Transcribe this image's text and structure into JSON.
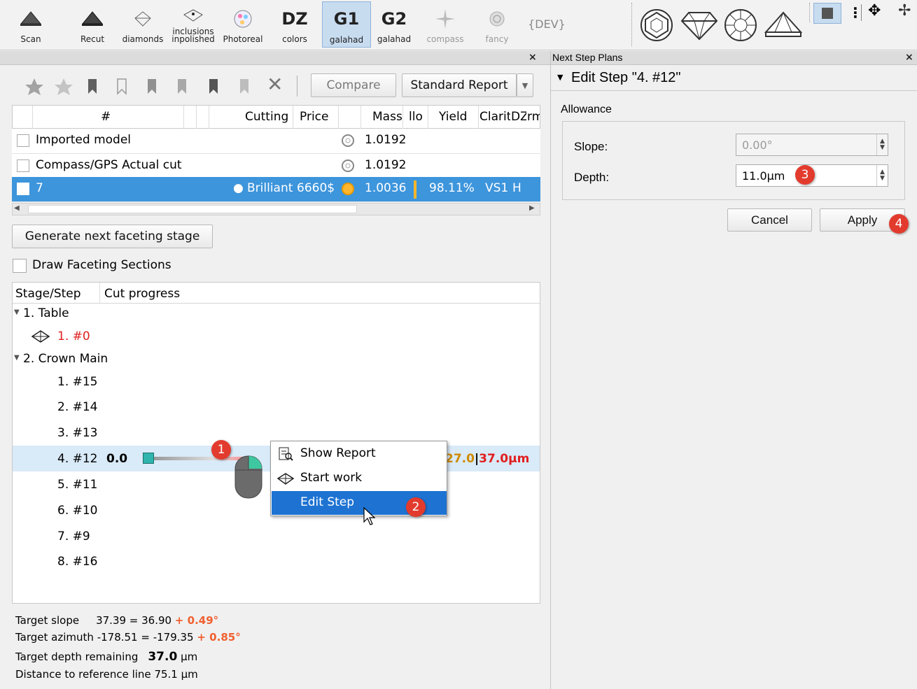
{
  "toolbar": {
    "scan": "Scan",
    "recut": "Recut",
    "diamonds": "diamonds",
    "inclusions_top": "inclusions",
    "inclusions_bottom": "inpolished",
    "photoreal": "Photoreal",
    "dz_big": "DZ",
    "dz_small": "colors",
    "g1_big": "G1",
    "g1_small": "galahad",
    "g2_big": "G2",
    "g2_small": "galahad",
    "compass": "compass",
    "fancy": "fancy",
    "dev": "{DEV}"
  },
  "left_panel": {
    "compare_label": "Compare",
    "report_label": "Standard Report",
    "columns": [
      "#",
      "Cutting",
      "Price",
      "Mass",
      "llo",
      "Yield",
      "Clarity",
      "DZ",
      "rm"
    ],
    "rows": [
      {
        "name": "Imported model",
        "mass": "1.0192"
      },
      {
        "name": "Compass/GPS Actual cut",
        "mass": "1.0192"
      },
      {
        "name": "7",
        "cutting": "Brilliant",
        "price": "6660$",
        "mass": "1.0036",
        "yield": "98.11%",
        "clarity": "VS1",
        "dz": "H"
      }
    ],
    "generate_label": "Generate next faceting stage",
    "draw_sections_label": "Draw Faceting Sections",
    "tree_headers": [
      "Stage/Step",
      "Cut progress"
    ],
    "stages": [
      {
        "label": "1. Table",
        "steps": [
          "1. #0"
        ]
      },
      {
        "label": "2. Crown Main",
        "steps": [
          "1. #15",
          "2. #14",
          "3. #13",
          "4. #12",
          "5. #11",
          "6. #10",
          "7. #9",
          "8. #16"
        ]
      }
    ],
    "selected_step_value": "0.0",
    "progress_orange": "27.0",
    "progress_red": "37.0μm",
    "info": {
      "slope_label": "Target slope",
      "slope_values": "37.39 =  36.90",
      "slope_delta": "+ 0.49°",
      "azimuth_label": "Target azimuth",
      "azimuth_values": "-178.51 = -179.35",
      "azimuth_delta": "+ 0.85°",
      "depth_label": "Target depth remaining",
      "depth_value": "37.0",
      "depth_unit": "μm",
      "distance_label": "Distance to reference line",
      "distance_value": "75.1 μm"
    }
  },
  "context_menu": {
    "items": [
      "Show Report",
      "Start work",
      "Edit Step"
    ]
  },
  "right_panel": {
    "title": "Next Step Plans",
    "section_title": "Edit Step \"4. #12\"",
    "group_label": "Allowance",
    "slope_label": "Slope:",
    "slope_value": "0.00°",
    "depth_label": "Depth:",
    "depth_value": "11.0μm",
    "cancel_label": "Cancel",
    "apply_label": "Apply"
  },
  "badges": [
    "1",
    "2",
    "3",
    "4"
  ],
  "colors": {
    "selection": "#3d95dc",
    "menu_highlight": "#1e73d2",
    "badge": "#e23b2e",
    "red_text": "#e02020",
    "orange_text": "#d08a00",
    "delta_text": "#f06030",
    "row_highlight": "#d9eaf8"
  }
}
